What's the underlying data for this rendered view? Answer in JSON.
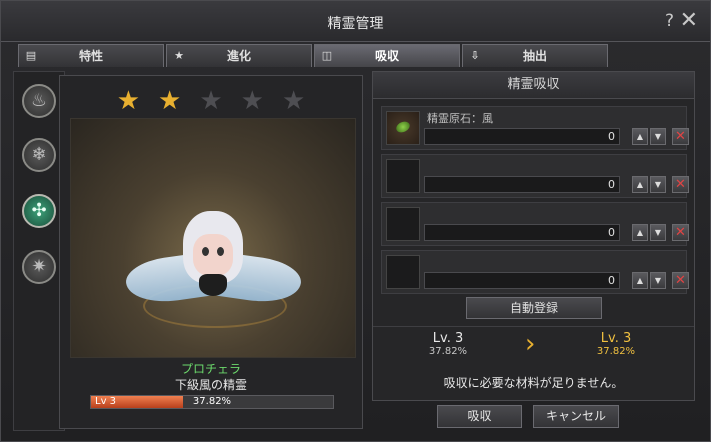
{
  "window": {
    "title": "精霊管理"
  },
  "header_icons": {
    "help": "?",
    "close": "✕"
  },
  "tabs": [
    {
      "label": "特性",
      "icon": "trait-icon"
    },
    {
      "label": "進化",
      "icon": "star-icon"
    },
    {
      "label": "吸収",
      "icon": "absorb-icon",
      "active": true
    },
    {
      "label": "抽出",
      "icon": "extract-icon"
    }
  ],
  "element_buttons": [
    "fire",
    "water",
    "wind",
    "dark"
  ],
  "selected_element": "wind",
  "stars": {
    "filled": 2,
    "total": 5
  },
  "spirit": {
    "name": "プロチェラ",
    "type": "下級風の精霊",
    "level_label": "Lv 3",
    "exp_percent": "37.82%",
    "exp_fraction": 0.3782
  },
  "absorb": {
    "title": "精霊吸収",
    "slots": [
      {
        "label": "精霊原石：風",
        "value": "0",
        "has_item": true
      },
      {
        "label": "",
        "value": "0",
        "has_item": false
      },
      {
        "label": "",
        "value": "0",
        "has_item": false
      },
      {
        "label": "",
        "value": "0",
        "has_item": false
      }
    ],
    "auto_register_label": "自動登録",
    "current": {
      "level": "Lv. 3",
      "percent": "37.82%"
    },
    "next": {
      "level": "Lv. 3",
      "percent": "37.82%"
    },
    "message": "吸収に必要な材料が足りません。"
  },
  "buttons": {
    "absorb": "吸収",
    "cancel": "キャンセル"
  },
  "colors": {
    "accent": "#e8b030",
    "name_green": "#6cd96c",
    "exp_fill": "#e06030",
    "remove_red": "#e04444"
  }
}
